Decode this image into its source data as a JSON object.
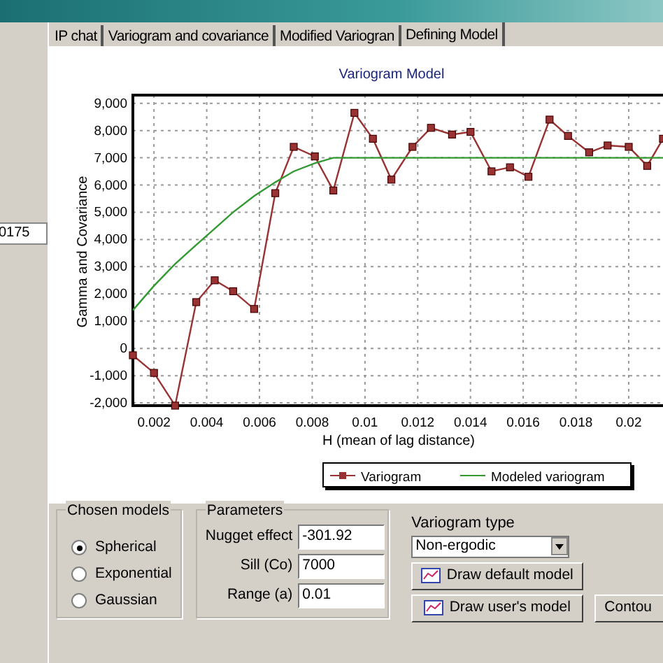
{
  "side_field": {
    "value": "0175"
  },
  "tabs": [
    {
      "label": "IP chat",
      "selected": false
    },
    {
      "label": "Variogram and covariance",
      "selected": false
    },
    {
      "label": "Modified Variogran",
      "selected": false
    },
    {
      "label": "Defining Model",
      "selected": true
    }
  ],
  "chart_data": {
    "type": "line",
    "title": "Variogram Model",
    "xlabel": "H (mean of lag distance)",
    "ylabel": "Gamma and Covariance",
    "x": [
      0.0012,
      0.002,
      0.0028,
      0.0036,
      0.0043,
      0.005,
      0.0058,
      0.0066,
      0.0073,
      0.0081,
      0.0088,
      0.0096,
      0.0103,
      0.011,
      0.0118,
      0.0125,
      0.0133,
      0.014,
      0.0148,
      0.0155,
      0.0162,
      0.017,
      0.0177,
      0.0185,
      0.0192,
      0.02,
      0.0207,
      0.0213
    ],
    "grid": true,
    "legend": true,
    "series": [
      {
        "name": "Variogram",
        "color": "#993333",
        "marker": "square",
        "values": [
          -250,
          -900,
          -2100,
          1700,
          2500,
          2100,
          1450,
          5700,
          7400,
          7050,
          5800,
          8650,
          7700,
          6200,
          7400,
          8100,
          7850,
          7950,
          6500,
          6650,
          6300,
          8400,
          7800,
          7200,
          7450,
          7400,
          6700,
          7700
        ]
      },
      {
        "name": "Modeled variogram",
        "color": "#339933",
        "values": [
          1400,
          2300,
          3100,
          3800,
          4400,
          5000,
          5600,
          6100,
          6500,
          6800,
          7000,
          7000,
          7000,
          7000,
          7000,
          7000,
          7000,
          7000,
          7000,
          7000,
          7000,
          7000,
          7000,
          7000,
          7000,
          7000,
          7000,
          7000
        ]
      }
    ],
    "xlim": [
      0.0012,
      0.0213
    ],
    "ylim": [
      -2100,
      9300
    ],
    "xticks": [
      {
        "value": 0.002,
        "label": "0.002"
      },
      {
        "value": 0.004,
        "label": "0.004"
      },
      {
        "value": 0.006,
        "label": "0.006"
      },
      {
        "value": 0.008,
        "label": "0.008"
      },
      {
        "value": 0.01,
        "label": "0.01"
      },
      {
        "value": 0.012,
        "label": "0.012"
      },
      {
        "value": 0.014,
        "label": "0.014"
      },
      {
        "value": 0.016,
        "label": "0.016"
      },
      {
        "value": 0.018,
        "label": "0.018"
      },
      {
        "value": 0.02,
        "label": "0.02"
      }
    ],
    "yticks": [
      {
        "value": 9000,
        "label": "9,000"
      },
      {
        "value": 8000,
        "label": "8,000"
      },
      {
        "value": 7000,
        "label": "7,000"
      },
      {
        "value": 6000,
        "label": "6,000"
      },
      {
        "value": 5000,
        "label": "5,000"
      },
      {
        "value": 4000,
        "label": "4,000"
      },
      {
        "value": 3000,
        "label": "3,000"
      },
      {
        "value": 2000,
        "label": "2,000"
      },
      {
        "value": 1000,
        "label": "1,000"
      },
      {
        "value": 0,
        "label": "0"
      },
      {
        "value": -1000,
        "label": "-1,000"
      },
      {
        "value": -2000,
        "label": "-2,000"
      }
    ]
  },
  "chosen_models": {
    "title": "Chosen models",
    "options": [
      {
        "label": "Spherical",
        "selected": true
      },
      {
        "label": "Exponential",
        "selected": false
      },
      {
        "label": "Gaussian",
        "selected": false
      }
    ]
  },
  "parameters": {
    "title": "Parameters",
    "fields": [
      {
        "label": "Nugget effect",
        "value": "-301.92"
      },
      {
        "label": "Sill (Co)",
        "value": "7000"
      },
      {
        "label": "Range (a)",
        "value": "0.01"
      }
    ]
  },
  "variogram_type": {
    "label": "Variogram type",
    "value": "Non-ergodic"
  },
  "buttons": [
    {
      "label": "Draw default model",
      "kind": "icon"
    },
    {
      "label": "Draw user's model",
      "kind": "icon"
    },
    {
      "label": "Contou",
      "kind": "plain"
    }
  ]
}
